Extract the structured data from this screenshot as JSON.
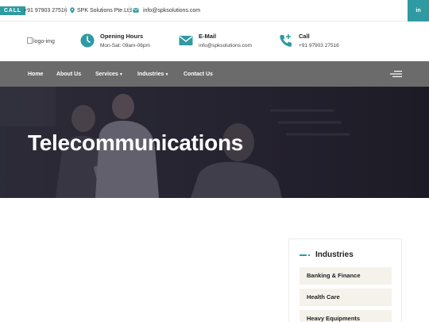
{
  "topbar": {
    "call_label": "CALL",
    "phone": "+91 97903 27516",
    "company": "SPK Solutions Pte.Ltd",
    "email": "info@spksolutions.com",
    "social_label": "in"
  },
  "header": {
    "logo_alt": "logo-img",
    "hours_title": "Opening Hours",
    "hours_value": "Mon-Sat: 09am-06pm",
    "email_title": "E-Mail",
    "email_value": "info@spksolutions.com",
    "call_title": "Call",
    "call_value": "+91 97903 27516"
  },
  "nav": {
    "items": [
      {
        "label": "Home"
      },
      {
        "label": "About Us"
      },
      {
        "label": "Services"
      },
      {
        "label": "Industries"
      },
      {
        "label": "Contact Us"
      }
    ]
  },
  "hero": {
    "title": "Telecommunications"
  },
  "sidebar": {
    "title": "Industries",
    "items": [
      {
        "label": "Banking & Finance"
      },
      {
        "label": "Health Care"
      },
      {
        "label": "Heavy Equipments"
      }
    ]
  },
  "colors": {
    "accent": "#2f9aa2",
    "nav_bg": "#6b6b6b",
    "hero_bg": "#2c2a37",
    "sidebar_item_bg": "#f5f2ec"
  },
  "icons": {
    "location": "map-pin-icon",
    "email": "envelope-icon",
    "hours": "clock-icon",
    "call": "phone-icon",
    "menu": "hamburger-icon",
    "social": "linkedin-icon"
  }
}
